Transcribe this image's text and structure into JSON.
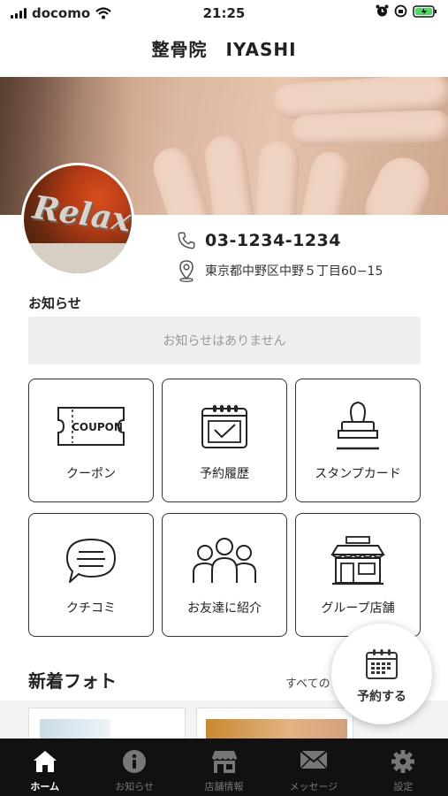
{
  "status_bar": {
    "carrier": "docomo",
    "time": "21:25"
  },
  "header": {
    "title": "整骨院　IYASHI"
  },
  "shop": {
    "avatar_text": "Relax",
    "phone": "03-1234-1234",
    "address": "東京都中野区中野５丁目60−15"
  },
  "news": {
    "label": "お知らせ",
    "empty_message": "お知らせはありません"
  },
  "menu": [
    {
      "label": "クーポン",
      "icon": "coupon-icon",
      "icon_text": "COUPON"
    },
    {
      "label": "予約履歴",
      "icon": "calendar-check-icon"
    },
    {
      "label": "スタンプカード",
      "icon": "stamp-icon"
    },
    {
      "label": "クチコミ",
      "icon": "speech-bubble-icon"
    },
    {
      "label": "お友達に紹介",
      "icon": "people-icon"
    },
    {
      "label": "グループ店舗",
      "icon": "store-icon"
    }
  ],
  "photos": {
    "title": "新着フォト",
    "see_all": "すべての"
  },
  "fab": {
    "label": "予約する",
    "icon": "calendar-icon"
  },
  "tabbar": [
    {
      "label": "ホーム",
      "icon": "home-icon",
      "active": true
    },
    {
      "label": "お知らせ",
      "icon": "info-icon",
      "active": false
    },
    {
      "label": "店舗情報",
      "icon": "shop-icon",
      "active": false
    },
    {
      "label": "メッセージ",
      "icon": "mail-icon",
      "active": false
    },
    {
      "label": "設定",
      "icon": "gear-icon",
      "active": false
    }
  ],
  "colors": {
    "tabbar_bg": "#111111",
    "battery": "#4cd964",
    "news_bg": "#eeeeee"
  }
}
